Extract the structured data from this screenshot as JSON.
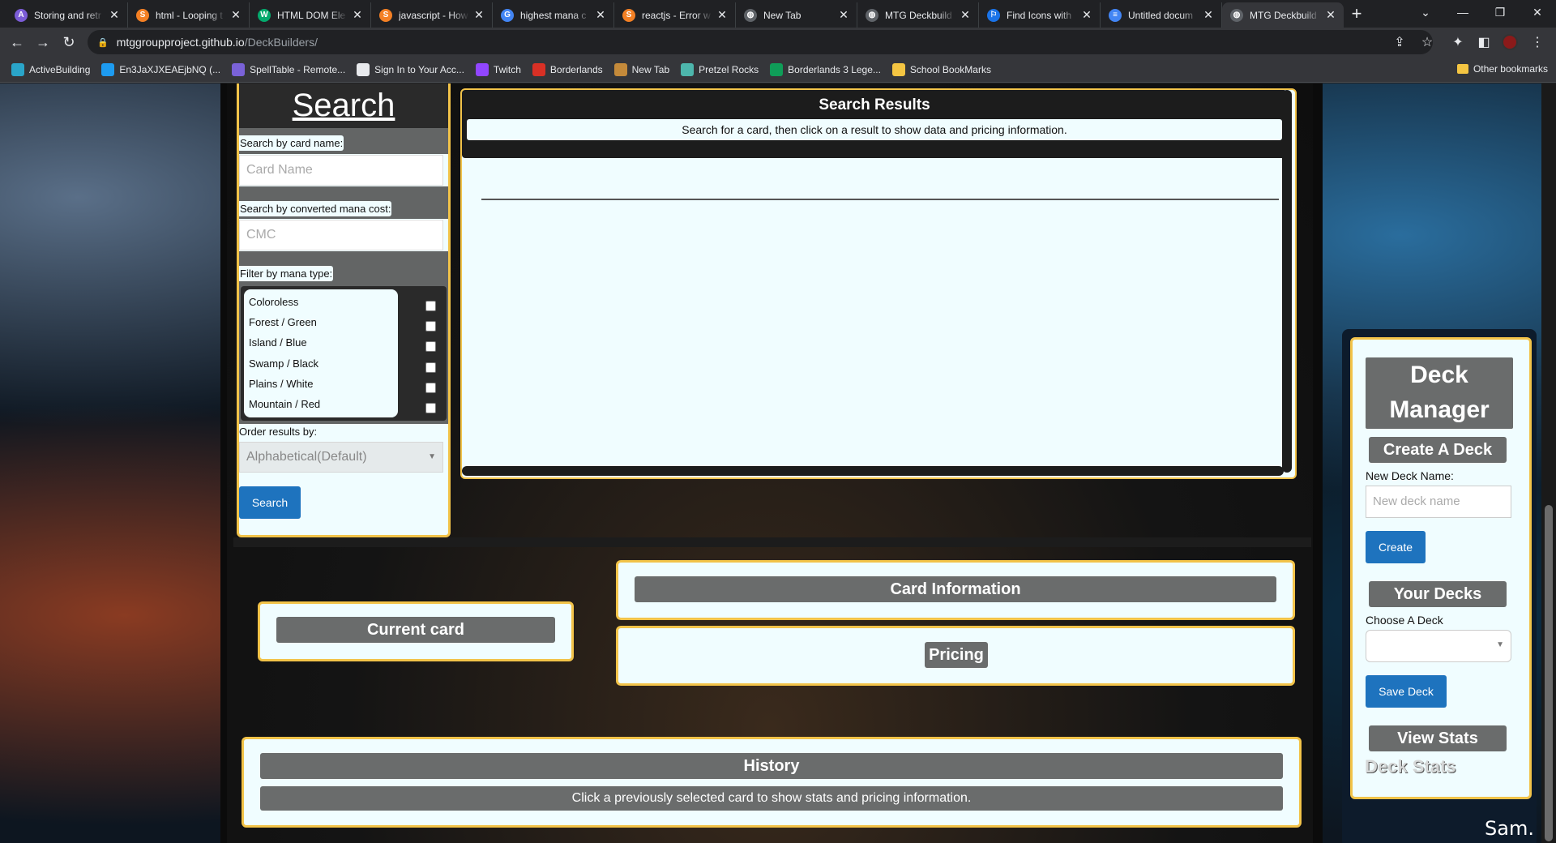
{
  "browser": {
    "tabs": [
      {
        "title": "Storing and retr",
        "color": "#7b5cd6",
        "glyph": "A"
      },
      {
        "title": "html - Looping t",
        "color": "#f48024",
        "glyph": "S"
      },
      {
        "title": "HTML DOM Ele",
        "color": "#04aa6d",
        "glyph": "W"
      },
      {
        "title": "javascript - How",
        "color": "#f48024",
        "glyph": "S"
      },
      {
        "title": "highest mana c",
        "color": "#4285f4",
        "glyph": "G"
      },
      {
        "title": "reactjs - Error w",
        "color": "#f48024",
        "glyph": "S"
      },
      {
        "title": "New Tab",
        "color": "#5f6368",
        "glyph": "◍"
      },
      {
        "title": "MTG Deckbuild",
        "color": "#5f6368",
        "glyph": "◍"
      },
      {
        "title": "Find Icons with",
        "color": "#1a73e8",
        "glyph": "⚐"
      },
      {
        "title": "Untitled docum",
        "color": "#4285f4",
        "glyph": "≡"
      },
      {
        "title": "MTG Deckbuild",
        "color": "#5f6368",
        "glyph": "◍"
      }
    ],
    "url_host": "mtggroupproject.github.io",
    "url_path": "/DeckBuilders/",
    "bookmarks": [
      {
        "label": "ActiveBuilding",
        "color": "#2aa5c9"
      },
      {
        "label": "En3JaXJXEAEjbNQ (...",
        "color": "#1d9bf0"
      },
      {
        "label": "SpellTable - Remote...",
        "color": "#7a62d8"
      },
      {
        "label": "Sign In to Your Acc...",
        "color": "#e8eaed"
      },
      {
        "label": "Twitch",
        "color": "#9146ff"
      },
      {
        "label": "Borderlands",
        "color": "#d93025"
      },
      {
        "label": "New Tab",
        "color": "#c48a3a"
      },
      {
        "label": "Pretzel Rocks",
        "color": "#4db6ac"
      },
      {
        "label": "Borderlands 3 Lege...",
        "color": "#0f9d58"
      },
      {
        "label": "School BookMarks",
        "color": "#f4c542"
      }
    ],
    "other_bookmarks": "Other bookmarks"
  },
  "search": {
    "title": "Search",
    "name_label": "Search by card name:",
    "name_placeholder": "Card Name",
    "cmc_label": "Search by converted mana cost:",
    "cmc_placeholder": "CMC",
    "mana_label": "Filter by mana type:",
    "mana_types": [
      "Coloroless",
      "Forest / Green",
      "Island / Blue",
      "Swamp / Black",
      "Plains / White",
      "Mountain / Red"
    ],
    "order_label": "Order results by:",
    "order_value": "Alphabetical(Default)",
    "button": "Search"
  },
  "results": {
    "title": "Search Results",
    "subtitle": "Search for a card, then click on a result to show data and pricing information."
  },
  "current_card": {
    "title": "Current card"
  },
  "card_info": {
    "title": "Card Information"
  },
  "pricing": {
    "title": "Pricing"
  },
  "history": {
    "title": "History",
    "subtitle": "Click a previously selected card to show stats and pricing information."
  },
  "deck_manager": {
    "title_line1": "Deck",
    "title_line2": "Manager",
    "create_header": "Create A Deck",
    "new_name_label": "New Deck Name:",
    "new_name_placeholder": "New deck name",
    "create_button": "Create",
    "your_decks_header": "Your Decks",
    "choose_label": "Choose A Deck",
    "save_button": "Save Deck",
    "view_stats_header": "View Stats",
    "deck_stats_label": "Deck Stats"
  },
  "signature": "Sam."
}
